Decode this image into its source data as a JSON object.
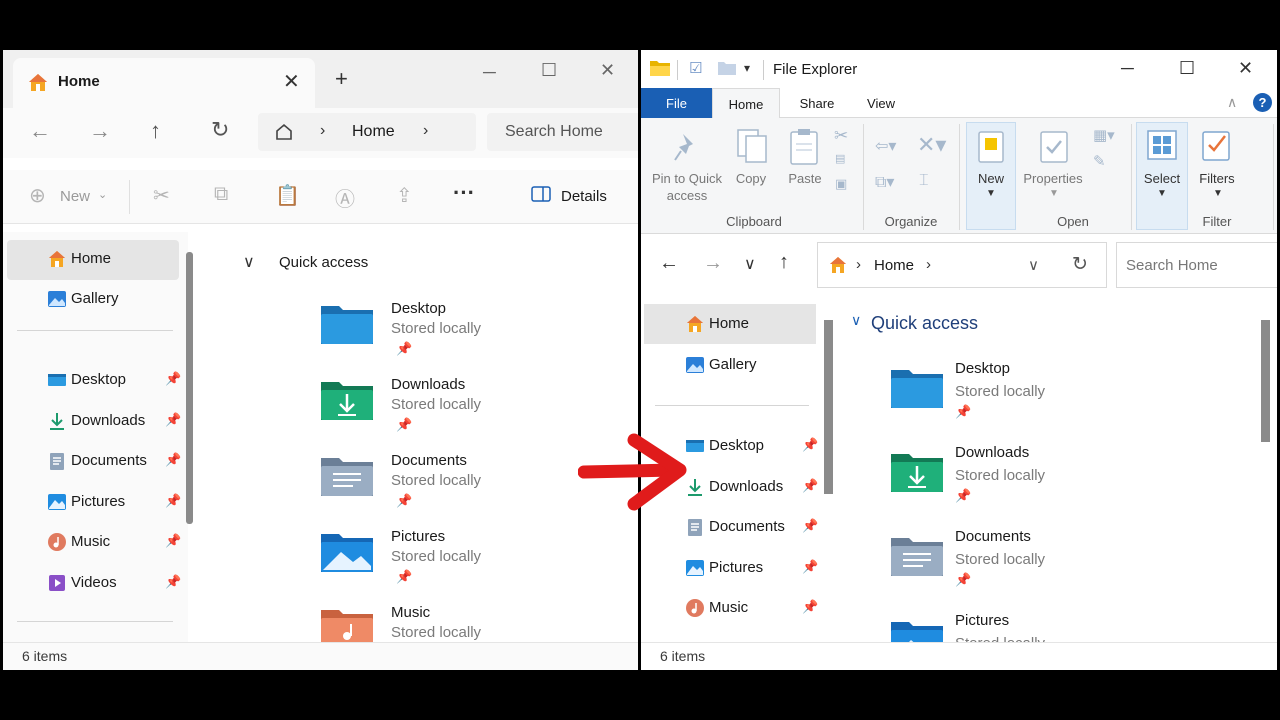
{
  "left_window": {
    "tab_title": "Home",
    "address_crumb": "Home",
    "search_placeholder": "Search Home",
    "new_label": "New",
    "details_label": "Details",
    "nav_items": [
      {
        "label": "Home",
        "icon": "home-icon"
      },
      {
        "label": "Gallery",
        "icon": "gallery-icon"
      },
      {
        "label": "Desktop",
        "icon": "desktop-icon",
        "pinned": true
      },
      {
        "label": "Downloads",
        "icon": "downloads-icon",
        "pinned": true
      },
      {
        "label": "Documents",
        "icon": "documents-icon",
        "pinned": true
      },
      {
        "label": "Pictures",
        "icon": "pictures-icon",
        "pinned": true
      },
      {
        "label": "Music",
        "icon": "music-icon",
        "pinned": true
      },
      {
        "label": "Videos",
        "icon": "videos-icon",
        "pinned": true
      }
    ],
    "section_header": "Quick access",
    "files": [
      {
        "name": "Desktop",
        "sub": "Stored locally",
        "icon": "desktop-folder-icon"
      },
      {
        "name": "Downloads",
        "sub": "Stored locally",
        "icon": "downloads-folder-icon"
      },
      {
        "name": "Documents",
        "sub": "Stored locally",
        "icon": "documents-folder-icon"
      },
      {
        "name": "Pictures",
        "sub": "Stored locally",
        "icon": "pictures-folder-icon"
      },
      {
        "name": "Music",
        "sub": "Stored locally",
        "icon": "music-folder-icon"
      }
    ],
    "status": "6 items"
  },
  "right_window": {
    "title": "File Explorer",
    "tabs": [
      "File",
      "Home",
      "Share",
      "View"
    ],
    "ribbon": {
      "pin_label_1": "Pin to Quick",
      "pin_label_2": "access",
      "copy": "Copy",
      "paste": "Paste",
      "new": "New",
      "properties": "Properties",
      "select": "Select",
      "filters": "Filters",
      "groups": [
        "Clipboard",
        "Organize",
        "Open",
        "Filter"
      ]
    },
    "address_crumb": "Home",
    "search_placeholder": "Search Home",
    "nav_items": [
      {
        "label": "Home",
        "icon": "home-icon"
      },
      {
        "label": "Gallery",
        "icon": "gallery-icon"
      },
      {
        "label": "Desktop",
        "icon": "desktop-icon",
        "pinned": true
      },
      {
        "label": "Downloads",
        "icon": "downloads-icon",
        "pinned": true
      },
      {
        "label": "Documents",
        "icon": "documents-icon",
        "pinned": true
      },
      {
        "label": "Pictures",
        "icon": "pictures-icon",
        "pinned": true
      },
      {
        "label": "Music",
        "icon": "music-icon",
        "pinned": true
      }
    ],
    "section_header": "Quick access",
    "files": [
      {
        "name": "Desktop",
        "sub": "Stored locally",
        "icon": "desktop-folder-icon"
      },
      {
        "name": "Downloads",
        "sub": "Stored locally",
        "icon": "downloads-folder-icon"
      },
      {
        "name": "Documents",
        "sub": "Stored locally",
        "icon": "documents-folder-icon"
      },
      {
        "name": "Pictures",
        "sub": "Stored locally",
        "icon": "pictures-folder-icon"
      }
    ],
    "status": "6 items"
  },
  "colors": {
    "accent_blue": "#1a5fb4",
    "arrow_red": "#e01b1b",
    "selected_bg": "#e5e5e5",
    "frame": "#000000"
  }
}
